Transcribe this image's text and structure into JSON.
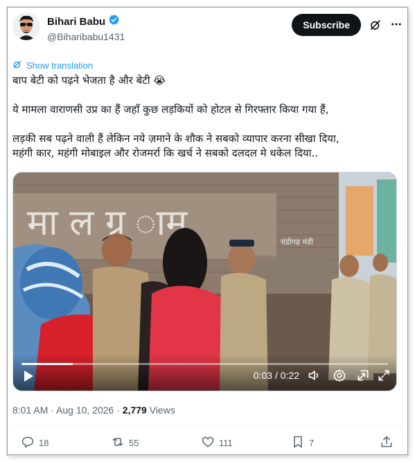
{
  "author": {
    "display_name": "Bihari Babu",
    "handle": "@Biharibabu1431",
    "verified": true,
    "verified_color": "#1d9bf0"
  },
  "header": {
    "subscribe_label": "Subscribe",
    "grok_icon": "grok-icon",
    "more_icon": "more-icon"
  },
  "translation": {
    "label": "Show translation"
  },
  "tweet": {
    "line1": "बाप बेटी को पढ़ने भेजता है और बेटी 😭",
    "line2": "ये मामला वाराणसी उप्र का हैं जहाँ कुछ लड़कियों को होटल से गिरफ्तार किया गया हैं,",
    "line3": "लड़की सब पढ़ने वाली हैं लेकिन नये ज़माने के शौक ने सबको व्यापार करना सीखा दिया,",
    "line4": "महंगी कार, महंगी मोबाइल और रोजमर्रा कि खर्च ने सबको दलदल मे धकेल दिया.."
  },
  "video": {
    "time_display": "0:03 / 0:22",
    "progress": 0.14,
    "wall_text": "चंडीगढ़ मंडी"
  },
  "meta": {
    "time": "8:01 AM",
    "separator": " · ",
    "date": "Aug 10, 2026",
    "views_count": "2,779",
    "views_label": " Views"
  },
  "actions": {
    "replies": "18",
    "reposts": "55",
    "likes": "111",
    "bookmarks": "7"
  }
}
